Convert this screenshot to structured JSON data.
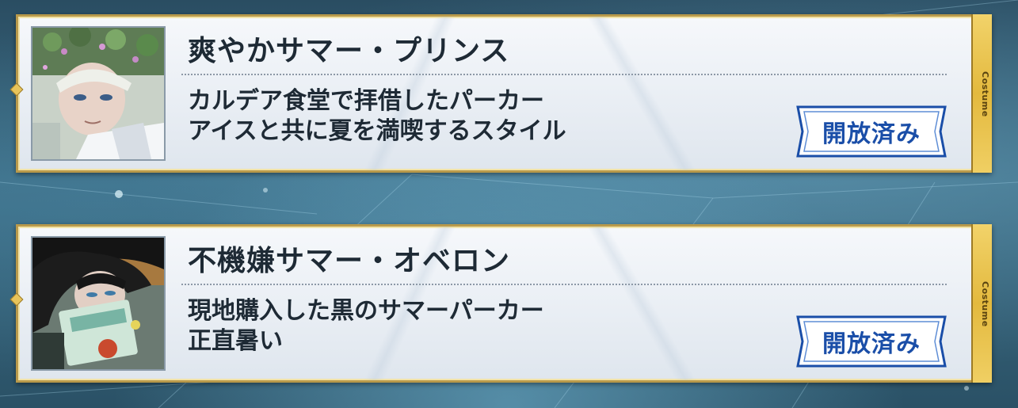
{
  "costumes": [
    {
      "title": "爽やかサマー・プリンス",
      "desc_line1": "カルデア食堂で拝借したパーカー",
      "desc_line2": "アイスと共に夏を満喫するスタイル",
      "status": "開放済み",
      "tag": "Costume",
      "portrait_icon": "costume-portrait-flower-crown"
    },
    {
      "title": "不機嫌サマー・オベロン",
      "desc_line1": "現地購入した黒のサマーパーカー",
      "desc_line2": "正直暑い",
      "status": "開放済み",
      "tag": "Costume",
      "portrait_icon": "costume-portrait-dark-hair"
    }
  ],
  "colors": {
    "frame_gold": "#b99a4b",
    "status_blue": "#1a4ea8",
    "text_dark": "#1e2a35"
  }
}
